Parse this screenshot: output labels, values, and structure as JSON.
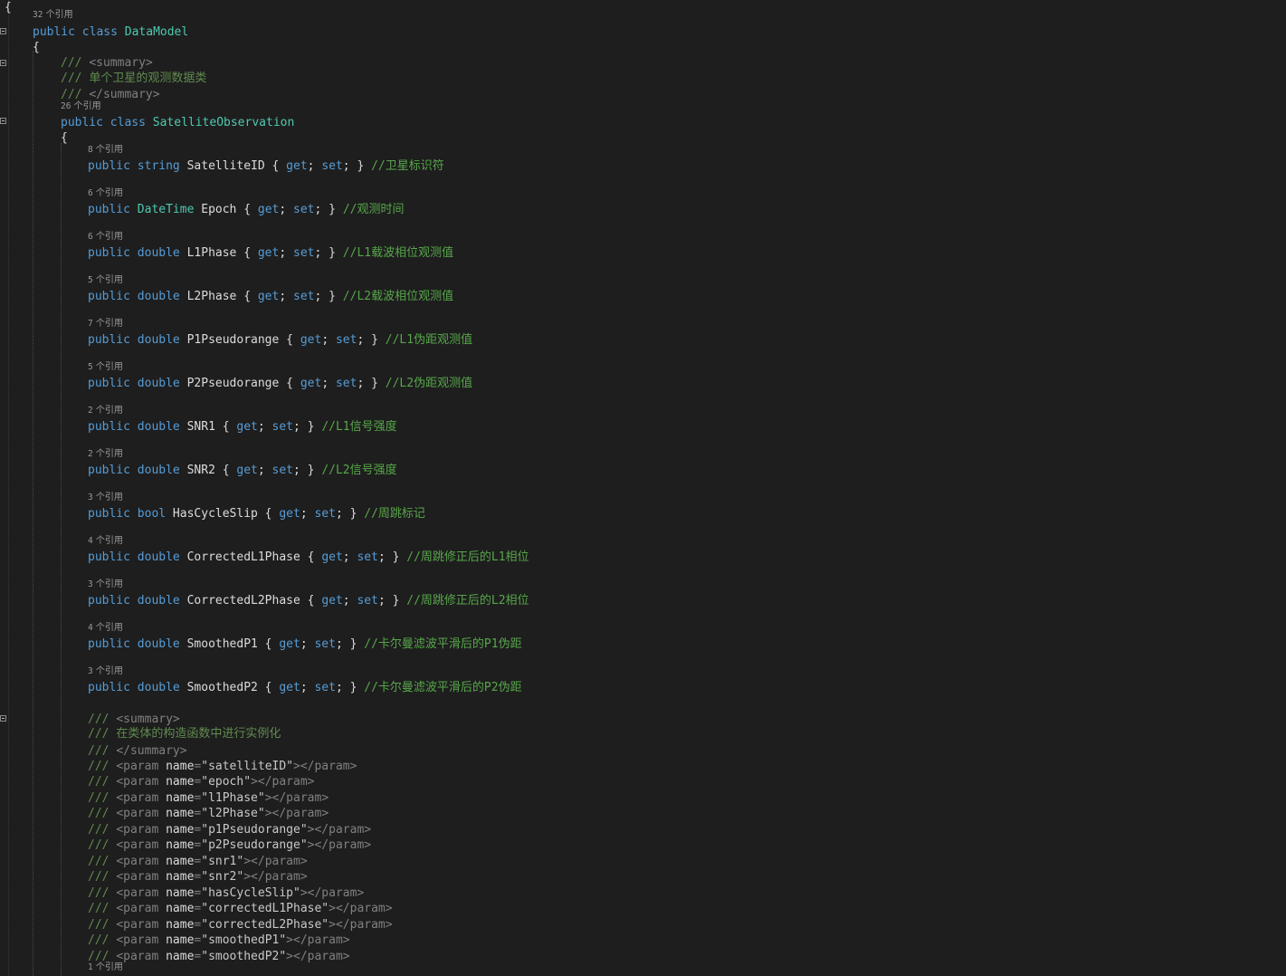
{
  "theme": {
    "background": "#1e1e1e",
    "keyword": "#569cd6",
    "type": "#4ec9b0",
    "identifier": "#dcdcdc",
    "comment": "#57a64a",
    "doc_comment": "#608b4e",
    "doc_tag": "#808080",
    "xml_string": "#c8c8c8",
    "codelens": "#999999"
  },
  "lines": [
    {
      "kind": "code",
      "tokens": [
        [
          "{",
          "p"
        ]
      ]
    },
    {
      "kind": "lens",
      "count": "32",
      "text": " 个引用"
    },
    {
      "kind": "code",
      "tokens": [
        [
          "public",
          "kw"
        ],
        [
          " ",
          "p"
        ],
        [
          "class",
          "kw"
        ],
        [
          " ",
          "p"
        ],
        [
          "DataModel",
          "ty"
        ]
      ]
    },
    {
      "kind": "code",
      "tokens": [
        [
          "{",
          "p"
        ]
      ]
    },
    {
      "kind": "code",
      "tokens": [
        [
          "/// ",
          "dc"
        ],
        [
          "<summary>",
          "dt"
        ]
      ]
    },
    {
      "kind": "code",
      "tokens": [
        [
          "/// ",
          "dc"
        ],
        [
          "单个卫星的观测数据类",
          "dc"
        ]
      ]
    },
    {
      "kind": "code",
      "tokens": [
        [
          "/// ",
          "dc"
        ],
        [
          "</summary>",
          "dt"
        ]
      ]
    },
    {
      "kind": "lens",
      "count": "26",
      "text": " 个引用"
    },
    {
      "kind": "code",
      "tokens": [
        [
          "public",
          "kw"
        ],
        [
          " ",
          "p"
        ],
        [
          "class",
          "kw"
        ],
        [
          " ",
          "p"
        ],
        [
          "SatelliteObservation",
          "ty"
        ]
      ]
    },
    {
      "kind": "code",
      "tokens": [
        [
          "{",
          "p"
        ]
      ]
    },
    {
      "kind": "lens",
      "count": "8",
      "text": " 个引用"
    },
    {
      "kind": "code",
      "tokens": [
        [
          "public",
          "kw"
        ],
        [
          " ",
          "p"
        ],
        [
          "string",
          "kw"
        ],
        [
          " SatelliteID { ",
          "p"
        ],
        [
          "get",
          "kw"
        ],
        [
          "; ",
          "p"
        ],
        [
          "set",
          "kw"
        ],
        [
          "; } ",
          "p"
        ],
        [
          "//卫星标识符",
          "cm"
        ]
      ]
    },
    {
      "kind": "lens",
      "count": "6",
      "text": " 个引用"
    },
    {
      "kind": "code",
      "tokens": [
        [
          "public",
          "kw"
        ],
        [
          " ",
          "p"
        ],
        [
          "DateTime",
          "ty"
        ],
        [
          " Epoch { ",
          "p"
        ],
        [
          "get",
          "kw"
        ],
        [
          "; ",
          "p"
        ],
        [
          "set",
          "kw"
        ],
        [
          "; } ",
          "p"
        ],
        [
          "//观测时间",
          "cm"
        ]
      ]
    },
    {
      "kind": "lens",
      "count": "6",
      "text": " 个引用"
    },
    {
      "kind": "code",
      "tokens": [
        [
          "public",
          "kw"
        ],
        [
          " ",
          "p"
        ],
        [
          "double",
          "kw"
        ],
        [
          " L1Phase { ",
          "p"
        ],
        [
          "get",
          "kw"
        ],
        [
          "; ",
          "p"
        ],
        [
          "set",
          "kw"
        ],
        [
          "; } ",
          "p"
        ],
        [
          "//L1载波相位观测值",
          "cm"
        ]
      ]
    },
    {
      "kind": "lens",
      "count": "5",
      "text": " 个引用"
    },
    {
      "kind": "code",
      "tokens": [
        [
          "public",
          "kw"
        ],
        [
          " ",
          "p"
        ],
        [
          "double",
          "kw"
        ],
        [
          " L2Phase { ",
          "p"
        ],
        [
          "get",
          "kw"
        ],
        [
          "; ",
          "p"
        ],
        [
          "set",
          "kw"
        ],
        [
          "; } ",
          "p"
        ],
        [
          "//L2载波相位观测值",
          "cm"
        ]
      ]
    },
    {
      "kind": "lens",
      "count": "7",
      "text": " 个引用"
    },
    {
      "kind": "code",
      "tokens": [
        [
          "public",
          "kw"
        ],
        [
          " ",
          "p"
        ],
        [
          "double",
          "kw"
        ],
        [
          " P1Pseudorange { ",
          "p"
        ],
        [
          "get",
          "kw"
        ],
        [
          "; ",
          "p"
        ],
        [
          "set",
          "kw"
        ],
        [
          "; } ",
          "p"
        ],
        [
          "//L1伪距观测值",
          "cm"
        ]
      ]
    },
    {
      "kind": "lens",
      "count": "5",
      "text": " 个引用"
    },
    {
      "kind": "code",
      "tokens": [
        [
          "public",
          "kw"
        ],
        [
          " ",
          "p"
        ],
        [
          "double",
          "kw"
        ],
        [
          " P2Pseudorange { ",
          "p"
        ],
        [
          "get",
          "kw"
        ],
        [
          "; ",
          "p"
        ],
        [
          "set",
          "kw"
        ],
        [
          "; } ",
          "p"
        ],
        [
          "//L2伪距观测值",
          "cm"
        ]
      ]
    },
    {
      "kind": "lens",
      "count": "2",
      "text": " 个引用"
    },
    {
      "kind": "code",
      "tokens": [
        [
          "public",
          "kw"
        ],
        [
          " ",
          "p"
        ],
        [
          "double",
          "kw"
        ],
        [
          " SNR1 { ",
          "p"
        ],
        [
          "get",
          "kw"
        ],
        [
          "; ",
          "p"
        ],
        [
          "set",
          "kw"
        ],
        [
          "; } ",
          "p"
        ],
        [
          "//L1信号强度",
          "cm"
        ]
      ]
    },
    {
      "kind": "lens",
      "count": "2",
      "text": " 个引用"
    },
    {
      "kind": "code",
      "tokens": [
        [
          "public",
          "kw"
        ],
        [
          " ",
          "p"
        ],
        [
          "double",
          "kw"
        ],
        [
          " SNR2 { ",
          "p"
        ],
        [
          "get",
          "kw"
        ],
        [
          "; ",
          "p"
        ],
        [
          "set",
          "kw"
        ],
        [
          "; } ",
          "p"
        ],
        [
          "//L2信号强度",
          "cm"
        ]
      ]
    },
    {
      "kind": "lens",
      "count": "3",
      "text": " 个引用"
    },
    {
      "kind": "code",
      "tokens": [
        [
          "public",
          "kw"
        ],
        [
          " ",
          "p"
        ],
        [
          "bool",
          "kw"
        ],
        [
          " HasCycleSlip { ",
          "p"
        ],
        [
          "get",
          "kw"
        ],
        [
          "; ",
          "p"
        ],
        [
          "set",
          "kw"
        ],
        [
          "; } ",
          "p"
        ],
        [
          "//周跳标记",
          "cm"
        ]
      ]
    },
    {
      "kind": "lens",
      "count": "4",
      "text": " 个引用"
    },
    {
      "kind": "code",
      "tokens": [
        [
          "public",
          "kw"
        ],
        [
          " ",
          "p"
        ],
        [
          "double",
          "kw"
        ],
        [
          " CorrectedL1Phase { ",
          "p"
        ],
        [
          "get",
          "kw"
        ],
        [
          "; ",
          "p"
        ],
        [
          "set",
          "kw"
        ],
        [
          "; } ",
          "p"
        ],
        [
          "//周跳修正后的L1相位",
          "cm"
        ]
      ]
    },
    {
      "kind": "lens",
      "count": "3",
      "text": " 个引用"
    },
    {
      "kind": "code",
      "tokens": [
        [
          "public",
          "kw"
        ],
        [
          " ",
          "p"
        ],
        [
          "double",
          "kw"
        ],
        [
          " CorrectedL2Phase { ",
          "p"
        ],
        [
          "get",
          "kw"
        ],
        [
          "; ",
          "p"
        ],
        [
          "set",
          "kw"
        ],
        [
          "; } ",
          "p"
        ],
        [
          "//周跳修正后的L2相位",
          "cm"
        ]
      ]
    },
    {
      "kind": "lens",
      "count": "4",
      "text": " 个引用"
    },
    {
      "kind": "code",
      "tokens": [
        [
          "public",
          "kw"
        ],
        [
          " ",
          "p"
        ],
        [
          "double",
          "kw"
        ],
        [
          " SmoothedP1 { ",
          "p"
        ],
        [
          "get",
          "kw"
        ],
        [
          "; ",
          "p"
        ],
        [
          "set",
          "kw"
        ],
        [
          "; } ",
          "p"
        ],
        [
          "//卡尔曼滤波平滑后的P1伪距",
          "cm"
        ]
      ]
    },
    {
      "kind": "lens",
      "count": "3",
      "text": " 个引用"
    },
    {
      "kind": "code",
      "tokens": [
        [
          "public",
          "kw"
        ],
        [
          " ",
          "p"
        ],
        [
          "double",
          "kw"
        ],
        [
          " SmoothedP2 { ",
          "p"
        ],
        [
          "get",
          "kw"
        ],
        [
          "; ",
          "p"
        ],
        [
          "set",
          "kw"
        ],
        [
          "; } ",
          "p"
        ],
        [
          "//卡尔曼滤波平滑后的P2伪距",
          "cm"
        ]
      ]
    },
    {
      "kind": "code",
      "tokens": [
        [
          "/// ",
          "dc"
        ],
        [
          "<summary>",
          "dt"
        ]
      ]
    },
    {
      "kind": "code",
      "tokens": [
        [
          "/// ",
          "dc"
        ],
        [
          "在类体的构造函数中进行实例化",
          "dc"
        ]
      ]
    },
    {
      "kind": "code",
      "tokens": [
        [
          "/// ",
          "dc"
        ],
        [
          "</summary>",
          "dt"
        ]
      ]
    },
    {
      "kind": "code",
      "tokens": [
        [
          "/// ",
          "dc"
        ],
        [
          "<param ",
          "dt"
        ],
        [
          "name",
          "p"
        ],
        [
          "=",
          "dt"
        ],
        [
          "\"satelliteID\"",
          "xs"
        ],
        [
          "></param>",
          "dt"
        ]
      ]
    },
    {
      "kind": "code",
      "tokens": [
        [
          "/// ",
          "dc"
        ],
        [
          "<param ",
          "dt"
        ],
        [
          "name",
          "p"
        ],
        [
          "=",
          "dt"
        ],
        [
          "\"epoch\"",
          "xs"
        ],
        [
          "></param>",
          "dt"
        ]
      ]
    },
    {
      "kind": "code",
      "tokens": [
        [
          "/// ",
          "dc"
        ],
        [
          "<param ",
          "dt"
        ],
        [
          "name",
          "p"
        ],
        [
          "=",
          "dt"
        ],
        [
          "\"l1Phase\"",
          "xs"
        ],
        [
          "></param>",
          "dt"
        ]
      ]
    },
    {
      "kind": "code",
      "tokens": [
        [
          "/// ",
          "dc"
        ],
        [
          "<param ",
          "dt"
        ],
        [
          "name",
          "p"
        ],
        [
          "=",
          "dt"
        ],
        [
          "\"l2Phase\"",
          "xs"
        ],
        [
          "></param>",
          "dt"
        ]
      ]
    },
    {
      "kind": "code",
      "tokens": [
        [
          "/// ",
          "dc"
        ],
        [
          "<param ",
          "dt"
        ],
        [
          "name",
          "p"
        ],
        [
          "=",
          "dt"
        ],
        [
          "\"p1Pseudorange\"",
          "xs"
        ],
        [
          "></param>",
          "dt"
        ]
      ]
    },
    {
      "kind": "code",
      "tokens": [
        [
          "/// ",
          "dc"
        ],
        [
          "<param ",
          "dt"
        ],
        [
          "name",
          "p"
        ],
        [
          "=",
          "dt"
        ],
        [
          "\"p2Pseudorange\"",
          "xs"
        ],
        [
          "></param>",
          "dt"
        ]
      ]
    },
    {
      "kind": "code",
      "tokens": [
        [
          "/// ",
          "dc"
        ],
        [
          "<param ",
          "dt"
        ],
        [
          "name",
          "p"
        ],
        [
          "=",
          "dt"
        ],
        [
          "\"snr1\"",
          "xs"
        ],
        [
          "></param>",
          "dt"
        ]
      ]
    },
    {
      "kind": "code",
      "tokens": [
        [
          "/// ",
          "dc"
        ],
        [
          "<param ",
          "dt"
        ],
        [
          "name",
          "p"
        ],
        [
          "=",
          "dt"
        ],
        [
          "\"snr2\"",
          "xs"
        ],
        [
          "></param>",
          "dt"
        ]
      ]
    },
    {
      "kind": "code",
      "tokens": [
        [
          "/// ",
          "dc"
        ],
        [
          "<param ",
          "dt"
        ],
        [
          "name",
          "p"
        ],
        [
          "=",
          "dt"
        ],
        [
          "\"hasCycleSlip\"",
          "xs"
        ],
        [
          "></param>",
          "dt"
        ]
      ]
    },
    {
      "kind": "code",
      "tokens": [
        [
          "/// ",
          "dc"
        ],
        [
          "<param ",
          "dt"
        ],
        [
          "name",
          "p"
        ],
        [
          "=",
          "dt"
        ],
        [
          "\"correctedL1Phase\"",
          "xs"
        ],
        [
          "></param>",
          "dt"
        ]
      ]
    },
    {
      "kind": "code",
      "tokens": [
        [
          "/// ",
          "dc"
        ],
        [
          "<param ",
          "dt"
        ],
        [
          "name",
          "p"
        ],
        [
          "=",
          "dt"
        ],
        [
          "\"correctedL2Phase\"",
          "xs"
        ],
        [
          "></param>",
          "dt"
        ]
      ]
    },
    {
      "kind": "code",
      "tokens": [
        [
          "/// ",
          "dc"
        ],
        [
          "<param ",
          "dt"
        ],
        [
          "name",
          "p"
        ],
        [
          "=",
          "dt"
        ],
        [
          "\"smoothedP1\"",
          "xs"
        ],
        [
          "></param>",
          "dt"
        ]
      ]
    },
    {
      "kind": "code",
      "tokens": [
        [
          "/// ",
          "dc"
        ],
        [
          "<param ",
          "dt"
        ],
        [
          "name",
          "p"
        ],
        [
          "=",
          "dt"
        ],
        [
          "\"smoothedP2\"",
          "xs"
        ],
        [
          "></param>",
          "dt"
        ]
      ]
    },
    {
      "kind": "lens",
      "count": "1",
      "text": " 个引用"
    }
  ]
}
